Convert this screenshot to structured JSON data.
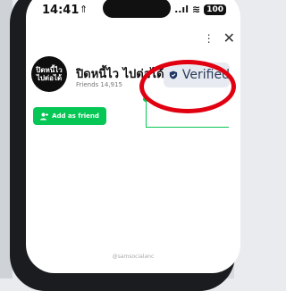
{
  "status_bar": {
    "time": "14:41",
    "time_icon": "⇑",
    "signal": "..ıl",
    "wifi": "≋",
    "battery": "100"
  },
  "toolbar": {
    "more": "⋮",
    "close": "✕"
  },
  "profile": {
    "avatar_text": "ปิดหนี้ไว ไปต่อได้",
    "name": "ปิดหนี้ไว ไปต่อได้",
    "friends": "Friends 14,915"
  },
  "verified": {
    "label": "Verified"
  },
  "actions": {
    "add_friend_label": "Add as friend",
    "add_friend_icon": "person-add-icon"
  },
  "footer": {
    "handle": "@samsocialanc"
  },
  "colors": {
    "accent": "#06c755",
    "highlight": "#e00010",
    "badge_bg": "#e7eaf0",
    "badge_text": "#2b3a5a"
  }
}
